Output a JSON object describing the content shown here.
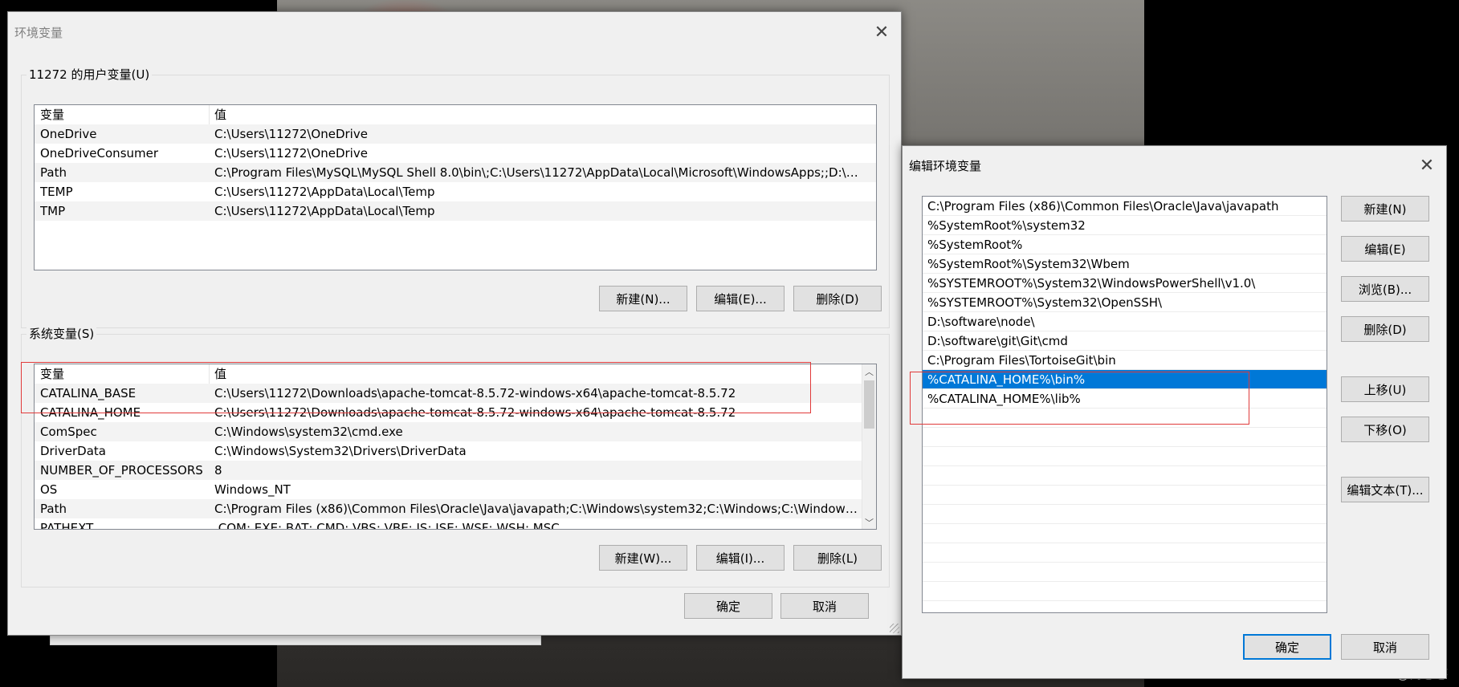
{
  "background": {
    "watermark": "CSDN @尚憨憨"
  },
  "env_dialog": {
    "title": "环境变量",
    "user_group_label": "11272 的用户变量(U)",
    "columns": [
      "变量",
      "值"
    ],
    "user_vars": [
      {
        "name": "OneDrive",
        "value": "C:\\Users\\11272\\OneDrive"
      },
      {
        "name": "OneDriveConsumer",
        "value": "C:\\Users\\11272\\OneDrive"
      },
      {
        "name": "Path",
        "value": "C:\\Program Files\\MySQL\\MySQL Shell 8.0\\bin\\;C:\\Users\\11272\\AppData\\Local\\Microsoft\\WindowsApps;;D:\\sof..."
      },
      {
        "name": "TEMP",
        "value": "C:\\Users\\11272\\AppData\\Local\\Temp"
      },
      {
        "name": "TMP",
        "value": "C:\\Users\\11272\\AppData\\Local\\Temp"
      }
    ],
    "user_buttons": {
      "new": "新建(N)...",
      "edit": "编辑(E)...",
      "delete": "删除(D)"
    },
    "system_group_label": "系统变量(S)",
    "system_vars": [
      {
        "name": "CATALINA_BASE",
        "value": "C:\\Users\\11272\\Downloads\\apache-tomcat-8.5.72-windows-x64\\apache-tomcat-8.5.72"
      },
      {
        "name": "CATALINA_HOME",
        "value": "C:\\Users\\11272\\Downloads\\apache-tomcat-8.5.72-windows-x64\\apache-tomcat-8.5.72"
      },
      {
        "name": "ComSpec",
        "value": "C:\\Windows\\system32\\cmd.exe"
      },
      {
        "name": "DriverData",
        "value": "C:\\Windows\\System32\\Drivers\\DriverData"
      },
      {
        "name": "NUMBER_OF_PROCESSORS",
        "value": "8"
      },
      {
        "name": "OS",
        "value": "Windows_NT"
      },
      {
        "name": "Path",
        "value": "C:\\Program Files (x86)\\Common Files\\Oracle\\Java\\javapath;C:\\Windows\\system32;C:\\Windows;C:\\Windows\\..."
      },
      {
        "name": "PATHEXT",
        "value": ".COM;.EXE;.BAT;.CMD;.VBS;.VBE;.JS;.JSE;.WSF;.WSH;.MSC"
      }
    ],
    "system_buttons": {
      "new": "新建(W)...",
      "edit": "编辑(I)...",
      "delete": "删除(L)"
    },
    "ok": "确定",
    "cancel": "取消"
  },
  "edit_dialog": {
    "title": "编辑环境变量",
    "paths": [
      "C:\\Program Files (x86)\\Common Files\\Oracle\\Java\\javapath",
      "%SystemRoot%\\system32",
      "%SystemRoot%",
      "%SystemRoot%\\System32\\Wbem",
      "%SYSTEMROOT%\\System32\\WindowsPowerShell\\v1.0\\",
      "%SYSTEMROOT%\\System32\\OpenSSH\\",
      "D:\\software\\node\\",
      "D:\\software\\git\\Git\\cmd",
      "C:\\Program Files\\TortoiseGit\\bin",
      "%CATALINA_HOME%\\bin%",
      "%CATALINA_HOME%\\lib%"
    ],
    "selected_index": 9,
    "buttons": {
      "new": "新建(N)",
      "edit": "编辑(E)",
      "browse": "浏览(B)...",
      "delete": "删除(D)",
      "move_up": "上移(U)",
      "move_down": "下移(O)",
      "edit_text": "编辑文本(T)..."
    },
    "ok": "确定",
    "cancel": "取消"
  }
}
